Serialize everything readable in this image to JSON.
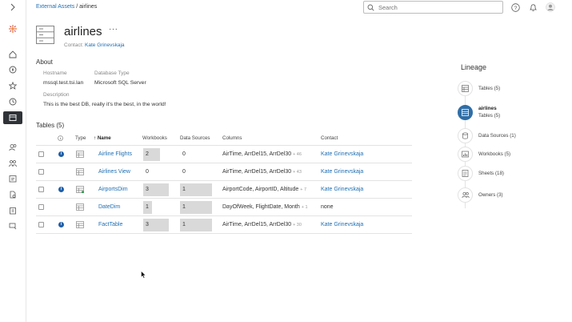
{
  "breadcrumb": {
    "parent": "External Assets",
    "separator": "/",
    "current": "airlines"
  },
  "search": {
    "placeholder": "Search"
  },
  "asset": {
    "title": "airlines",
    "more": "···",
    "contact_label": "Contact:",
    "contact_name": "Kate Grinevskaja"
  },
  "about": {
    "heading": "About",
    "hostname_label": "Hostname",
    "hostname_value": "mssql.test.tsi.lan",
    "dbtype_label": "Database Type",
    "dbtype_value": "Microsoft SQL Server",
    "description_label": "Description",
    "description_value": "This is the best DB, really it's the best, in the world!"
  },
  "tables": {
    "heading": "Tables (5)",
    "columns": {
      "type": "Type",
      "name": "↑ Name",
      "workbooks": "Workbooks",
      "data_sources": "Data Sources",
      "columns": "Columns",
      "contact": "Contact"
    },
    "rows": [
      {
        "info": true,
        "name": "Airline Flights",
        "workbooks": "2",
        "data_sources": "0",
        "columns": "AirTime, ArrDel15, ArrDel30",
        "more": "+ 46",
        "contact": "Kate Grinevskaja",
        "contact_is_link": true,
        "wb_fill": 0.67,
        "ds_fill": 0
      },
      {
        "info": false,
        "name": "Airlines View",
        "workbooks": "0",
        "data_sources": "0",
        "columns": "AirTime, ArrDel15, ArrDel30",
        "more": "+ 43",
        "contact": "Kate Grinevskaja",
        "contact_is_link": true,
        "wb_fill": 0,
        "ds_fill": 0
      },
      {
        "info": true,
        "name": "AirportsDim",
        "workbooks": "3",
        "data_sources": "1",
        "columns": "AirportCode, AirportID, Altitude",
        "more": "+ 7",
        "contact": "Kate Grinevskaja",
        "contact_is_link": true,
        "wb_fill": 1,
        "ds_fill": 1
      },
      {
        "info": false,
        "name": "DateDim",
        "workbooks": "1",
        "data_sources": "1",
        "columns": "DayOfWeek, FlightDate, Month",
        "more": "+ 1",
        "contact": "none",
        "contact_is_link": false,
        "wb_fill": 0.33,
        "ds_fill": 1
      },
      {
        "info": true,
        "name": "FactTable",
        "workbooks": "3",
        "data_sources": "1",
        "columns": "AirTime, ArrDel15, ArrDel30",
        "more": "+ 30",
        "contact": "Kate Grinevskaja",
        "contact_is_link": true,
        "wb_fill": 1,
        "ds_fill": 1
      }
    ]
  },
  "lineage": {
    "heading": "Lineage",
    "items": [
      {
        "label": "Tables (5)"
      },
      {
        "name": "airlines",
        "sub": "Tables (5)"
      },
      {
        "label": "Data Sources (1)"
      },
      {
        "label": "Workbooks (5)"
      },
      {
        "label": "Sheets (18)"
      },
      {
        "label": "Owners (3)"
      }
    ]
  },
  "colors": {
    "link": "#1f6fb3",
    "accent": "#2f6ea7",
    "bar": "#d9d9d9"
  }
}
